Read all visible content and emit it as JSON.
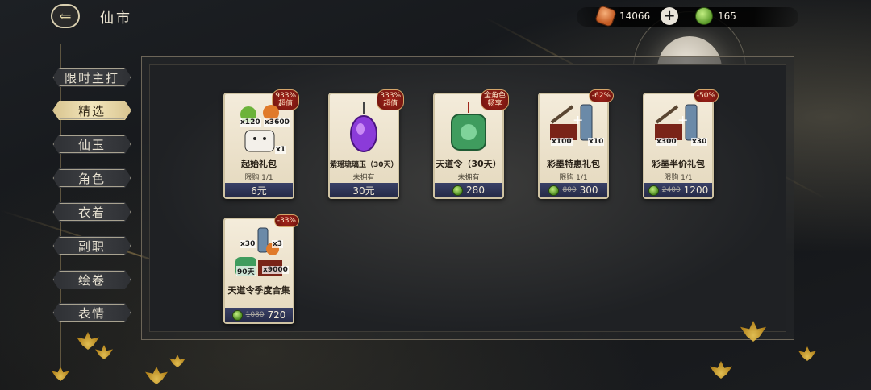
{
  "header": {
    "title": "仙市",
    "back_icon": "back-arrow-icon"
  },
  "currencies": {
    "ore": {
      "icon": "ore-crystal-icon",
      "amount": "14066"
    },
    "add_icon": "plus-icon",
    "jade": {
      "icon": "jade-icon",
      "amount": "165"
    }
  },
  "sidebar": {
    "items": [
      {
        "label": "限时主打",
        "active": false
      },
      {
        "label": "精选",
        "active": true
      },
      {
        "label": "仙玉",
        "active": false
      },
      {
        "label": "角色",
        "active": false
      },
      {
        "label": "衣着",
        "active": false
      },
      {
        "label": "副职",
        "active": false
      },
      {
        "label": "绘卷",
        "active": false
      },
      {
        "label": "表情",
        "active": false
      }
    ]
  },
  "products": [
    {
      "name": "起始礼包",
      "limit": "限购 1/1",
      "price": "6元",
      "badge": "933%\n超值",
      "qty": [
        "x120",
        "x3600",
        "x1"
      ],
      "currency": ""
    },
    {
      "name": "紫瑶琉璃玉（30天）",
      "limit": "未拥有",
      "price": "30元",
      "badge": "333%\n超值",
      "qty": [],
      "currency": ""
    },
    {
      "name": "天道令（30天）",
      "limit": "未拥有",
      "price": "280",
      "badge": "全角色\n畅享",
      "qty": [],
      "currency": "jade"
    },
    {
      "name": "彩墨特惠礼包",
      "limit": "限购 1/1",
      "price": "300",
      "old_price": "800",
      "badge": "-62%",
      "qty": [
        "x100",
        "x10"
      ],
      "currency": "jade"
    },
    {
      "name": "彩墨半价礼包",
      "limit": "限购 1/1",
      "price": "1200",
      "old_price": "2400",
      "badge": "-50%",
      "qty": [
        "x300",
        "x30"
      ],
      "currency": "jade"
    },
    {
      "name": "天道令季度合集",
      "limit": "",
      "price": "720",
      "old_price": "1080",
      "badge": "-33%",
      "qty": [
        "x30",
        "x3",
        "90天",
        "x9000"
      ],
      "currency": "jade"
    }
  ]
}
